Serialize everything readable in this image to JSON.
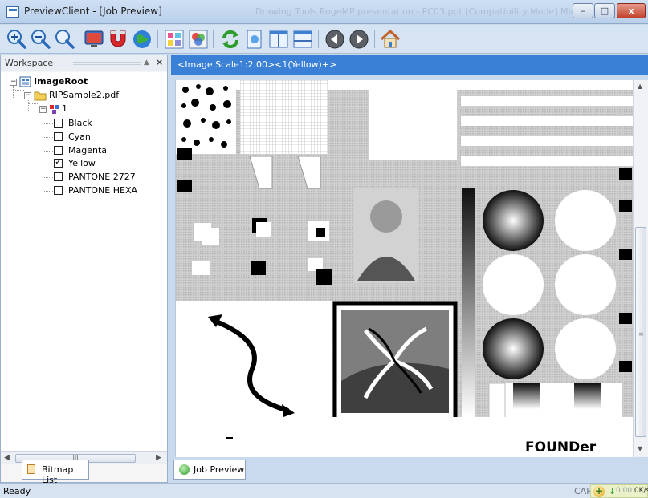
{
  "window": {
    "title": "PreviewClient - [Job Preview]",
    "background_title": "Drawing Tools   RogeMP presentation - PC03.ppt [Compatibility Mode]   Micro",
    "minimize_label": "–",
    "maximize_label": "□",
    "close_label": "x"
  },
  "toolbar": {
    "buttons": [
      {
        "name": "zoom-in",
        "icon": "zoom-in-icon"
      },
      {
        "name": "zoom-out",
        "icon": "zoom-out-icon"
      },
      {
        "name": "zoom-fit",
        "icon": "zoom-fit-icon"
      },
      {
        "name": "monitor",
        "icon": "monitor-icon"
      },
      {
        "name": "magnet",
        "icon": "magnet-icon"
      },
      {
        "name": "globe",
        "icon": "globe-icon"
      },
      {
        "name": "color-grid",
        "icon": "color-grid-icon"
      },
      {
        "name": "color-palette",
        "icon": "color-palette-icon"
      },
      {
        "name": "refresh",
        "icon": "refresh-icon"
      },
      {
        "name": "page",
        "icon": "page-icon"
      },
      {
        "name": "split-vertical",
        "icon": "split-vertical-icon"
      },
      {
        "name": "split-horizontal",
        "icon": "split-horizontal-icon"
      },
      {
        "name": "previous",
        "icon": "previous-icon"
      },
      {
        "name": "next",
        "icon": "next-icon"
      },
      {
        "name": "home",
        "icon": "home-icon"
      }
    ]
  },
  "workspace": {
    "title": "Workspace",
    "pin_label": "▲",
    "close_label": "×",
    "tree": {
      "root": "ImageRoot",
      "file": "RIPSample2.pdf",
      "page": "1",
      "separations": [
        {
          "label": "Black",
          "checked": false
        },
        {
          "label": "Cyan",
          "checked": false
        },
        {
          "label": "Magenta",
          "checked": false
        },
        {
          "label": "Yellow",
          "checked": true
        },
        {
          "label": "PANTONE 2727",
          "checked": false
        },
        {
          "label": "PANTONE HEXA",
          "checked": false
        }
      ]
    },
    "scroll_grip": "III",
    "bottom_tab": "Bitmap List"
  },
  "preview": {
    "path": "<Image Scale1:2.00><1(Yellow)+>",
    "brand_text": "FOUNDer",
    "tab_label": "Job Preview"
  },
  "status": {
    "text": "Ready",
    "cap": "CAP",
    "speed_dim": "0.00",
    "speed_unit": "0K/s"
  }
}
